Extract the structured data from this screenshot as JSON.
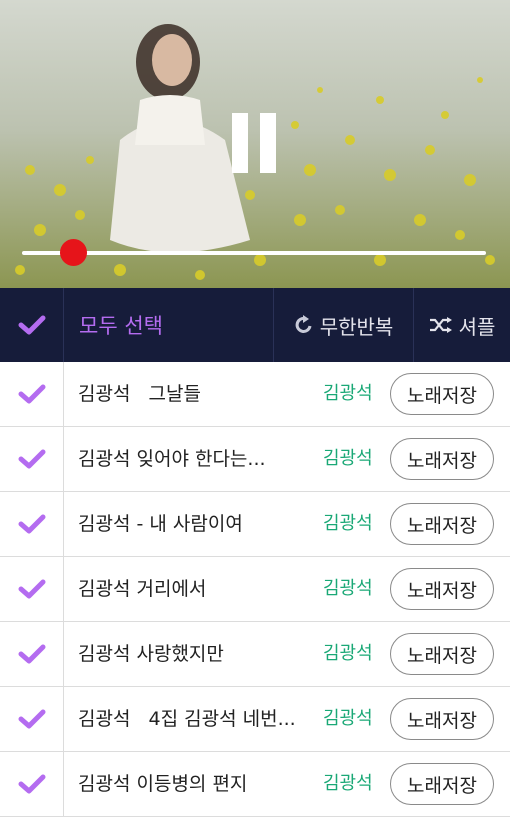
{
  "player": {
    "state": "playing",
    "progress_percent": 11,
    "pause_icon": "pause-icon"
  },
  "toolbar": {
    "select_all_label": "모두 선택",
    "repeat_label": "무한반복",
    "shuffle_label": "셔플",
    "check_icon": "check-icon",
    "repeat_icon": "repeat-icon",
    "shuffle_icon": "shuffle-icon"
  },
  "colors": {
    "toolbar_bg": "#161c3a",
    "accent_purple": "#b46cf0",
    "artist_green": "#1aa876",
    "seek_red": "#e6141a"
  },
  "songs": [
    {
      "title": "김광석   그날들",
      "artist": "김광석",
      "save_label": "노래저장"
    },
    {
      "title": "김광석 잊어야 한다는...",
      "artist": "김광석",
      "save_label": "노래저장"
    },
    {
      "title": "김광석 - 내 사람이여",
      "artist": "김광석",
      "save_label": "노래저장"
    },
    {
      "title": "김광석 거리에서",
      "artist": "김광석",
      "save_label": "노래저장"
    },
    {
      "title": "김광석 사랑했지만",
      "artist": "김광석",
      "save_label": "노래저장"
    },
    {
      "title": "김광석   4집 김광석 네번...",
      "artist": "김광석",
      "save_label": "노래저장"
    },
    {
      "title": "김광석 이등병의 편지",
      "artist": "김광석",
      "save_label": "노래저장"
    }
  ]
}
